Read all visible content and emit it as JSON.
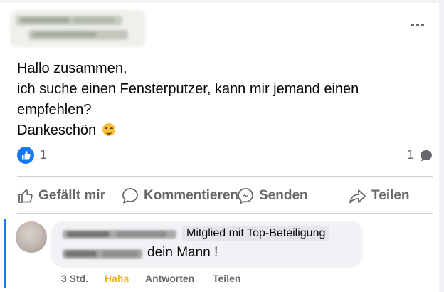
{
  "post": {
    "menu_icon": "more-horizontal-icon",
    "text_lines": [
      "Hallo zusammen,",
      "ich suche einen Fensterputzer, kann mir jemand einen",
      "empfehlen?",
      "Dankeschön"
    ],
    "emoji": "smiling-face-icon",
    "reactions": {
      "icon": "like-icon",
      "count": "1"
    },
    "comments": {
      "count": "1",
      "icon": "comment-bubble-icon"
    }
  },
  "actions": {
    "like_label": "Gefällt mir",
    "comment_label": "Kommentieren",
    "send_label": "Senden",
    "share_label": "Teilen"
  },
  "comment": {
    "badge": "Mitglied mit Top-Beteiligung",
    "text": "dein Mann !",
    "time": "3 Std.",
    "reaction_label": "Haha",
    "reply_label": "Antworten",
    "share_label": "Teilen"
  },
  "colors": {
    "accent": "#1877f2",
    "haha": "#f7b125",
    "muted": "#65676b",
    "bubble": "#f0f2f5"
  }
}
